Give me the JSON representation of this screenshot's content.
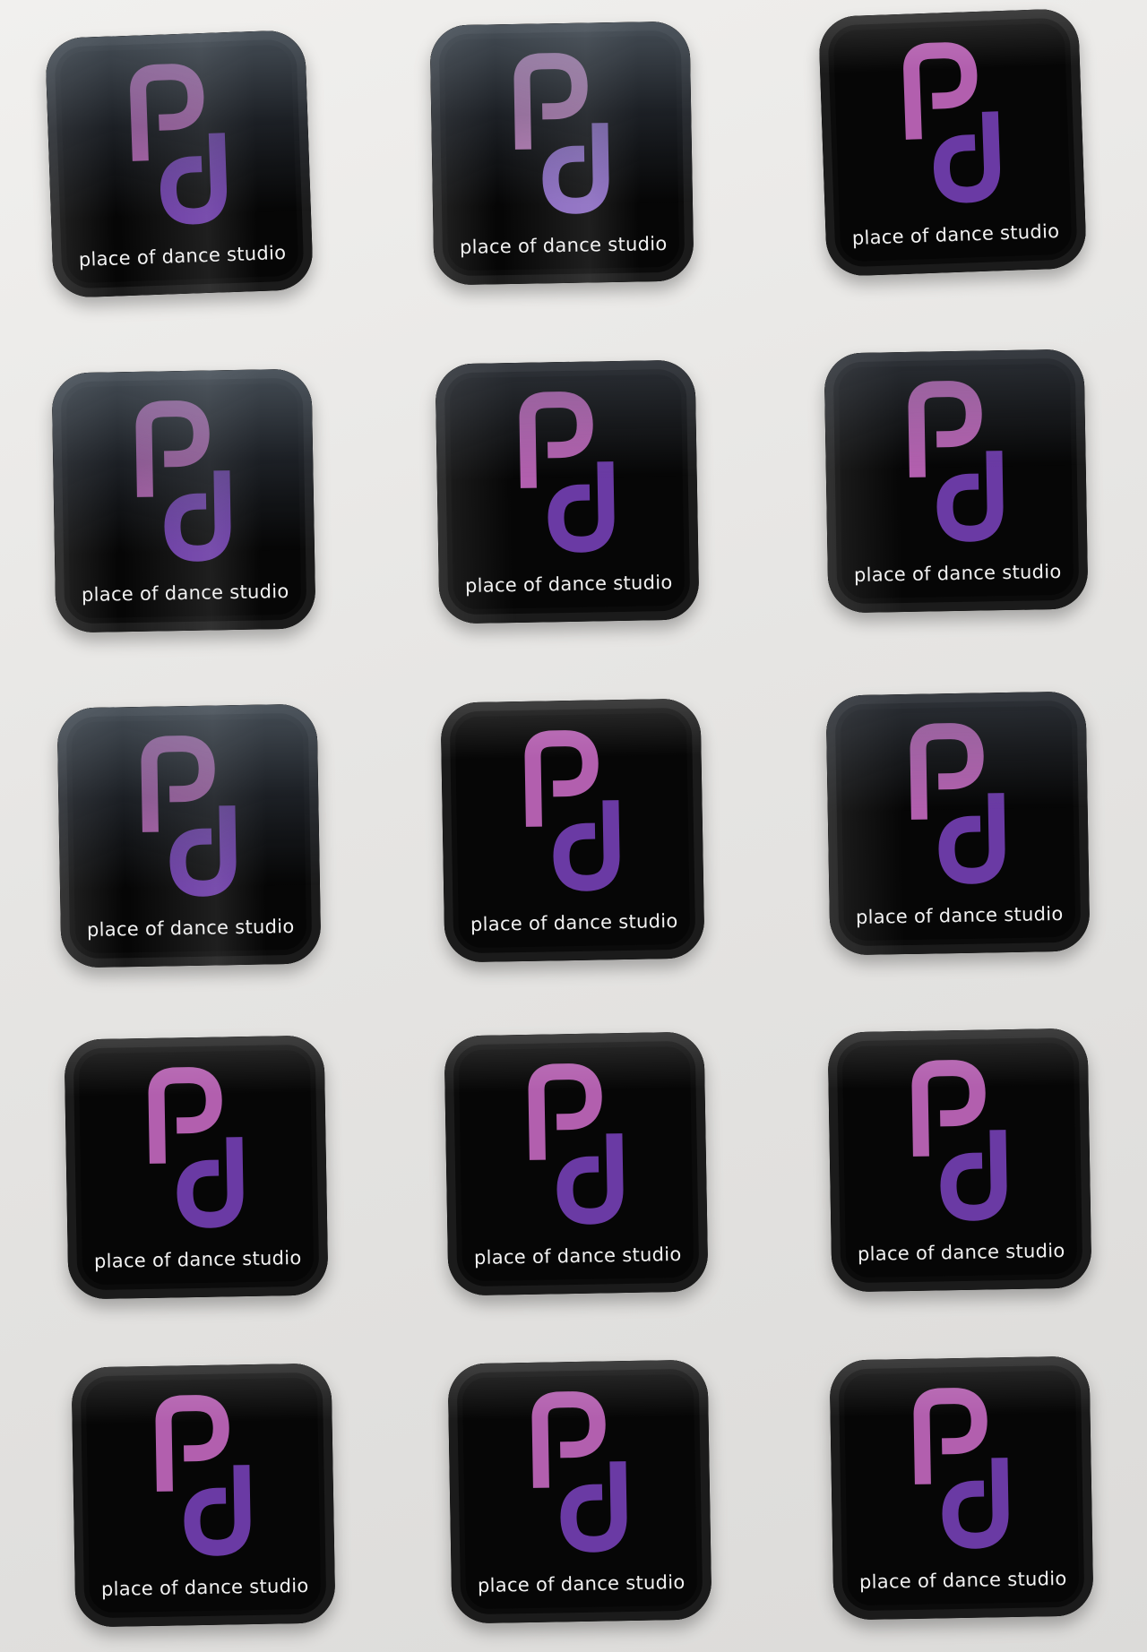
{
  "brand": {
    "caption": "place of dance studio",
    "colors": {
      "sticker_background": "#060606",
      "logo_p": "#b25fae",
      "logo_d": "#6a3aa4",
      "caption_text": "#f2f2f2",
      "sheet_background": "#e9e8e6"
    }
  },
  "stickers": [
    {
      "row": 1,
      "col": 1
    },
    {
      "row": 1,
      "col": 2
    },
    {
      "row": 1,
      "col": 3
    },
    {
      "row": 2,
      "col": 1
    },
    {
      "row": 2,
      "col": 2
    },
    {
      "row": 2,
      "col": 3
    },
    {
      "row": 3,
      "col": 1
    },
    {
      "row": 3,
      "col": 2
    },
    {
      "row": 3,
      "col": 3
    },
    {
      "row": 4,
      "col": 1
    },
    {
      "row": 4,
      "col": 2
    },
    {
      "row": 4,
      "col": 3
    },
    {
      "row": 5,
      "col": 1
    },
    {
      "row": 5,
      "col": 2
    },
    {
      "row": 5,
      "col": 3
    }
  ]
}
